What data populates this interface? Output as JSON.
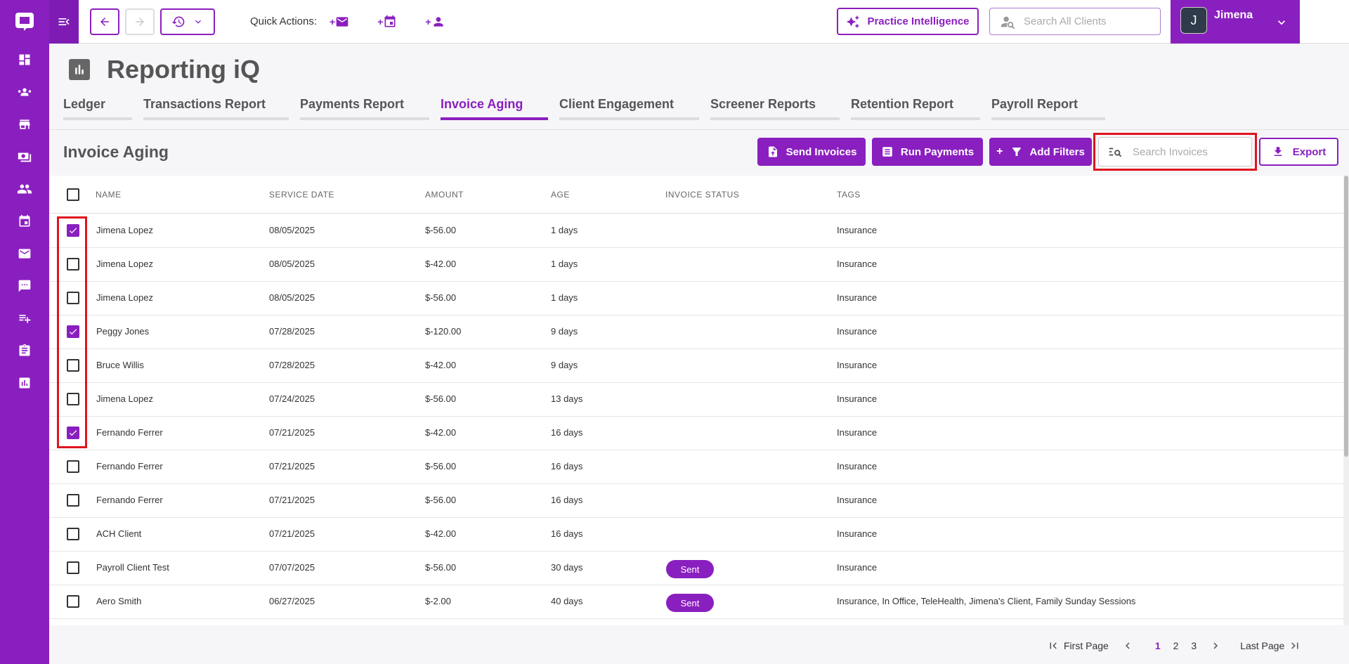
{
  "topbar": {
    "quick_actions_label": "Quick Actions:",
    "quick_actions": [
      {
        "prefix": "+",
        "icon": "mail-icon"
      },
      {
        "prefix": "+",
        "icon": "calendar-icon"
      },
      {
        "prefix": "+",
        "icon": "person-icon"
      }
    ],
    "practice_intelligence_label": "Practice Intelligence",
    "search_clients_placeholder": "Search All Clients",
    "user": {
      "initial": "J",
      "name": "Jimena"
    }
  },
  "page": {
    "title": "Reporting iQ",
    "tabs": [
      {
        "label": "Ledger",
        "active": false
      },
      {
        "label": "Transactions Report",
        "active": false
      },
      {
        "label": "Payments Report",
        "active": false
      },
      {
        "label": "Invoice Aging",
        "active": true
      },
      {
        "label": "Client Engagement",
        "active": false
      },
      {
        "label": "Screener Reports",
        "active": false
      },
      {
        "label": "Retention Report",
        "active": false
      },
      {
        "label": "Payroll Report",
        "active": false
      }
    ]
  },
  "section": {
    "title": "Invoice Aging",
    "send_invoices_label": "Send Invoices",
    "run_payments_label": "Run Payments",
    "add_filters_label": "Add Filters",
    "search_invoices_placeholder": "Search Invoices",
    "export_label": "Export"
  },
  "table": {
    "columns": [
      "NAME",
      "SERVICE DATE",
      "AMOUNT",
      "AGE",
      "INVOICE STATUS",
      "TAGS"
    ],
    "rows": [
      {
        "checked": true,
        "name": "Jimena Lopez",
        "date": "08/05/2025",
        "amount": "$-56.00",
        "age": "1 days",
        "status": "",
        "tags": "Insurance"
      },
      {
        "checked": false,
        "name": "Jimena Lopez",
        "date": "08/05/2025",
        "amount": "$-42.00",
        "age": "1 days",
        "status": "",
        "tags": "Insurance"
      },
      {
        "checked": false,
        "name": "Jimena Lopez",
        "date": "08/05/2025",
        "amount": "$-56.00",
        "age": "1 days",
        "status": "",
        "tags": "Insurance"
      },
      {
        "checked": true,
        "name": "Peggy Jones",
        "date": "07/28/2025",
        "amount": "$-120.00",
        "age": "9 days",
        "status": "",
        "tags": "Insurance"
      },
      {
        "checked": false,
        "name": "Bruce Willis",
        "date": "07/28/2025",
        "amount": "$-42.00",
        "age": "9 days",
        "status": "",
        "tags": "Insurance"
      },
      {
        "checked": false,
        "name": "Jimena Lopez",
        "date": "07/24/2025",
        "amount": "$-56.00",
        "age": "13 days",
        "status": "",
        "tags": "Insurance"
      },
      {
        "checked": true,
        "name": "Fernando Ferrer",
        "date": "07/21/2025",
        "amount": "$-42.00",
        "age": "16 days",
        "status": "",
        "tags": "Insurance"
      },
      {
        "checked": false,
        "name": "Fernando Ferrer",
        "date": "07/21/2025",
        "amount": "$-56.00",
        "age": "16 days",
        "status": "",
        "tags": "Insurance"
      },
      {
        "checked": false,
        "name": "Fernando Ferrer",
        "date": "07/21/2025",
        "amount": "$-56.00",
        "age": "16 days",
        "status": "",
        "tags": "Insurance"
      },
      {
        "checked": false,
        "name": "ACH Client",
        "date": "07/21/2025",
        "amount": "$-42.00",
        "age": "16 days",
        "status": "",
        "tags": "Insurance"
      },
      {
        "checked": false,
        "name": "Payroll Client Test",
        "date": "07/07/2025",
        "amount": "$-56.00",
        "age": "30 days",
        "status": "Sent",
        "tags": "Insurance"
      },
      {
        "checked": false,
        "name": "Aero Smith",
        "date": "06/27/2025",
        "amount": "$-2.00",
        "age": "40 days",
        "status": "Sent",
        "tags": "Insurance, In Office, TeleHealth, Jimena's Client, Family Sunday Sessions"
      }
    ]
  },
  "pagination": {
    "first_label": "First Page",
    "last_label": "Last Page",
    "pages": [
      "1",
      "2",
      "3"
    ],
    "current": "1"
  },
  "colors": {
    "accent": "#8a1fbf",
    "highlight": "#e0141e"
  }
}
